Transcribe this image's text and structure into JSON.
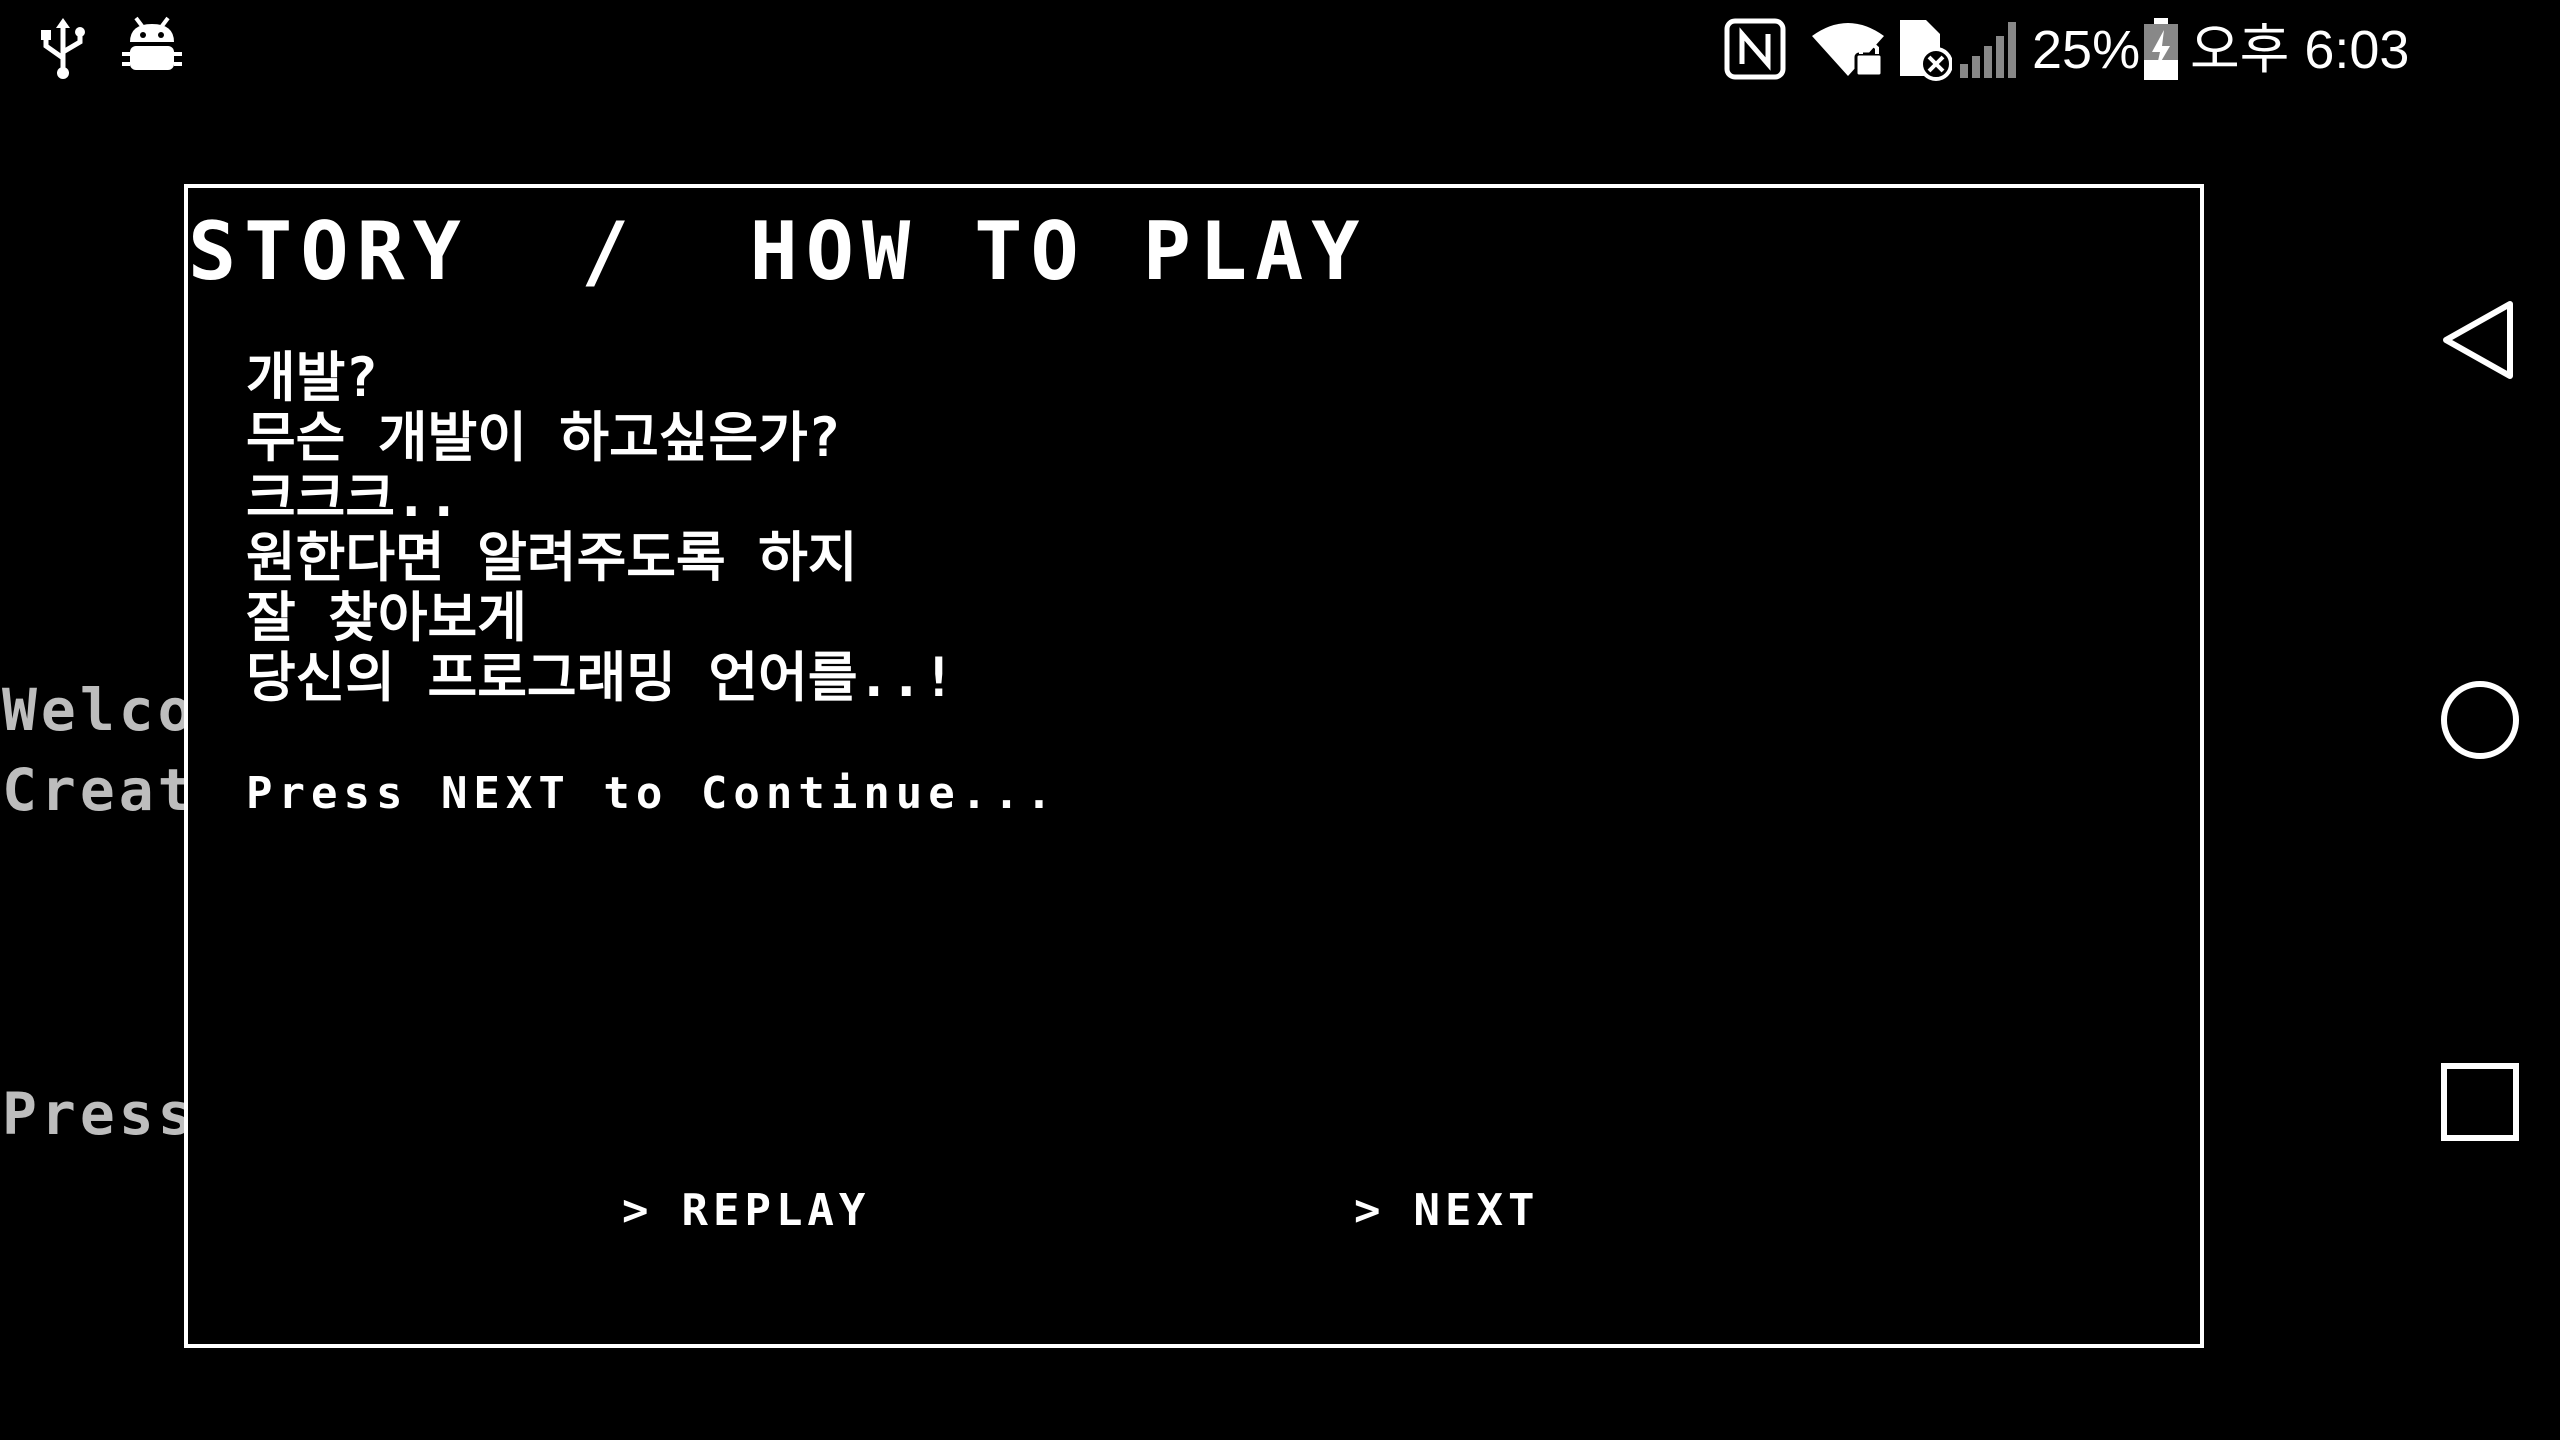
{
  "status_bar": {
    "battery_percent": "25%",
    "time": "오후 6:03",
    "icons": [
      "usb-icon",
      "android-debug-icon",
      "nfc-icon",
      "wifi-lock-icon",
      "sim-error-icon",
      "signal-icon",
      "battery-charging-icon"
    ]
  },
  "background": {
    "lines": [
      "Welcome",
      "Create",
      "Press"
    ]
  },
  "dialog": {
    "title": "STORY  /  HOW TO PLAY",
    "story_lines": [
      "개발?",
      "무슨 개발이 하고싶은가?",
      "크크크..",
      "원한다면 알려주도록 하지",
      "잘 찾아보게",
      "당신의 프로그래밍 언어를..!"
    ],
    "continue_hint": "Press NEXT to Continue...",
    "replay_label": "REPLAY",
    "next_label": "NEXT",
    "arrow": ">"
  },
  "nav_bar": {
    "icons": [
      "back-icon",
      "home-icon",
      "recents-icon"
    ]
  }
}
